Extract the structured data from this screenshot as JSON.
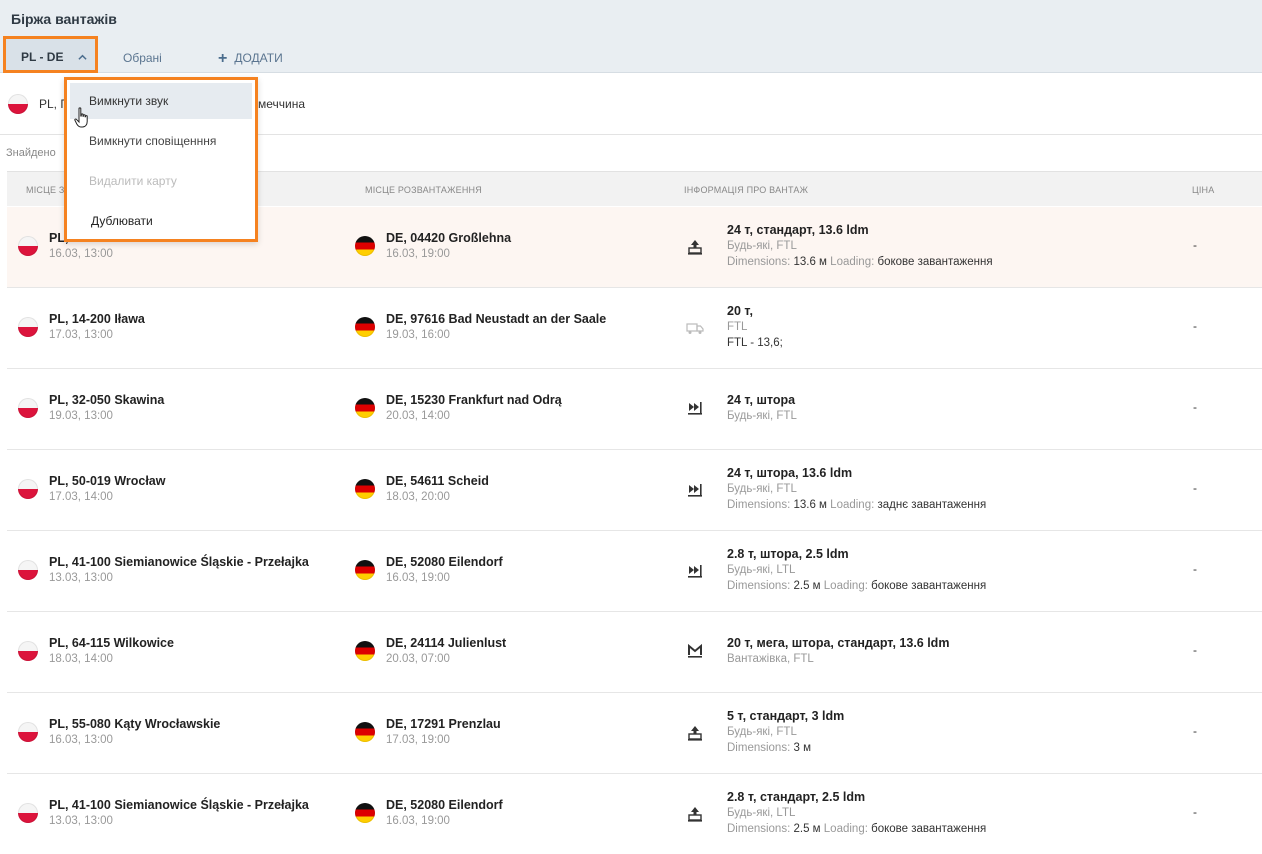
{
  "app": {
    "title": "Біржа вантажів"
  },
  "tabs": {
    "active": "PL - DE",
    "favorites": "Обрані",
    "add": "ДОДАТИ"
  },
  "route": {
    "from": "PL, П",
    "to_suffix": "меччина"
  },
  "found_label": "Знайдено",
  "columns": {
    "loading": "МІСЦЕ З",
    "unloading": "МІСЦЕ РОЗВАНТАЖЕННЯ",
    "cargo": "ІНФОРМАЦІЯ ПРО ВАНТАЖ",
    "price": "ЦІНА"
  },
  "menu": {
    "items": [
      {
        "label": "Вимкнути звук",
        "state": "hover"
      },
      {
        "label": "Вимкнути сповіщенння",
        "state": "normal"
      },
      {
        "label": "Видалити карту",
        "state": "disabled"
      },
      {
        "label": "Дублювати",
        "state": "normal"
      }
    ]
  },
  "rows": [
    {
      "from_place": "PL,",
      "from_date": "16.03, 13:00",
      "to_place": "DE, 04420 Großlehna",
      "to_date": "16.03, 19:00",
      "icon": "side-loading-icon",
      "cargo_main": "24 т, стандарт, 13.6 ldm",
      "cargo_type": "Будь-які, FTL",
      "details": [
        {
          "k": "Dimensions:",
          "v": "13.6 м"
        },
        {
          "k": "Loading:",
          "v": "бокове завантаження"
        }
      ],
      "price": "-"
    },
    {
      "from_place": "PL, 14-200 Iława",
      "from_date": "17.03, 13:00",
      "to_place": "DE, 97616 Bad Neustadt an der Saale",
      "to_date": "19.03, 16:00",
      "icon": "truck-icon",
      "cargo_main": "20 т,",
      "cargo_type": "FTL",
      "note": "FTL - 13,6;",
      "details": [],
      "price": "-"
    },
    {
      "from_place": "PL, 32-050 Skawina",
      "from_date": "19.03, 13:00",
      "to_place": "DE, 15230 Frankfurt nad Odrą",
      "to_date": "20.03, 14:00",
      "icon": "rear-loading-icon",
      "cargo_main": "24 т, штора",
      "cargo_type": "Будь-які, FTL",
      "details": [],
      "price": "-"
    },
    {
      "from_place": "PL, 50-019 Wrocław",
      "from_date": "17.03, 14:00",
      "to_place": "DE, 54611 Scheid",
      "to_date": "18.03, 20:00",
      "icon": "rear-loading-icon",
      "cargo_main": "24 т, штора, 13.6 ldm",
      "cargo_type": "Будь-які, FTL",
      "details": [
        {
          "k": "Dimensions:",
          "v": "13.6 м"
        },
        {
          "k": "Loading:",
          "v": "заднє завантаження"
        }
      ],
      "price": "-"
    },
    {
      "from_place": "PL, 41-100 Siemianowice Śląskie - Przełajka",
      "from_date": "13.03, 13:00",
      "to_place": "DE, 52080 Eilendorf",
      "to_date": "16.03, 19:00",
      "icon": "rear-loading-icon",
      "cargo_main": "2.8 т, штора, 2.5 ldm",
      "cargo_type": "Будь-які, LTL",
      "details": [
        {
          "k": "Dimensions:",
          "v": "2.5 м"
        },
        {
          "k": "Loading:",
          "v": "бокове завантаження"
        }
      ],
      "price": "-"
    },
    {
      "from_place": "PL, 64-115 Wilkowice",
      "from_date": "18.03, 14:00",
      "to_place": "DE, 24114 Julienlust",
      "to_date": "20.03, 07:00",
      "icon": "mega-icon",
      "cargo_main": "20 т, мега, штора, стандарт, 13.6 ldm",
      "cargo_type": "Вантажівка, FTL",
      "details": [],
      "price": "-"
    },
    {
      "from_place": "PL, 55-080 Kąty Wrocławskie",
      "from_date": "16.03, 13:00",
      "to_place": "DE, 17291 Prenzlau",
      "to_date": "17.03, 19:00",
      "icon": "side-loading-icon",
      "cargo_main": "5 т, стандарт, 3 ldm",
      "cargo_type": "Будь-які, FTL",
      "details": [
        {
          "k": "Dimensions:",
          "v": "3 м"
        }
      ],
      "price": "-"
    },
    {
      "from_place": "PL, 41-100 Siemianowice Śląskie - Przełajka",
      "from_date": "13.03, 13:00",
      "to_place": "DE, 52080 Eilendorf",
      "to_date": "16.03, 19:00",
      "icon": "side-loading-icon",
      "cargo_main": "2.8 т, стандарт, 2.5 ldm",
      "cargo_type": "Будь-які, LTL",
      "details": [
        {
          "k": "Dimensions:",
          "v": "2.5 м"
        },
        {
          "k": "Loading:",
          "v": "бокове завантаження"
        }
      ],
      "price": "-"
    }
  ]
}
